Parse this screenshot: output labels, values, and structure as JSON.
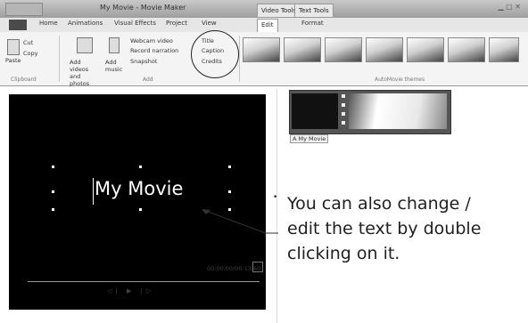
{
  "window": {
    "title": "My Movie - Movie Maker"
  },
  "context_tabs": {
    "video_tools": "Video Tools",
    "text_tools": "Text Tools"
  },
  "tabs": [
    "Home",
    "Animations",
    "Visual Effects",
    "Project",
    "View",
    "Edit",
    "Format"
  ],
  "ribbon": {
    "clipboard": {
      "paste": "Paste",
      "cut": "Cut",
      "copy": "Copy",
      "group": "Clipboard"
    },
    "add": {
      "add_videos": "Add videos and photos",
      "add_music": "Add music",
      "webcam": "Webcam video",
      "narration": "Record narration",
      "snapshot": "Snapshot",
      "title": "Title",
      "caption": "Caption",
      "credits": "Credits",
      "group": "Add"
    },
    "autoMovie_group": "AutoMovie themes"
  },
  "preview": {
    "overlay_text": "My Movie",
    "timecode": "00:00.00/00:13.60",
    "controls": "◁| ▶ |▷"
  },
  "storyboard": {
    "clip_label": "A My Movie"
  },
  "annotation": {
    "bullet": "•",
    "lines": [
      "You can also change /",
      "edit the text by double",
      "clicking on it."
    ]
  }
}
